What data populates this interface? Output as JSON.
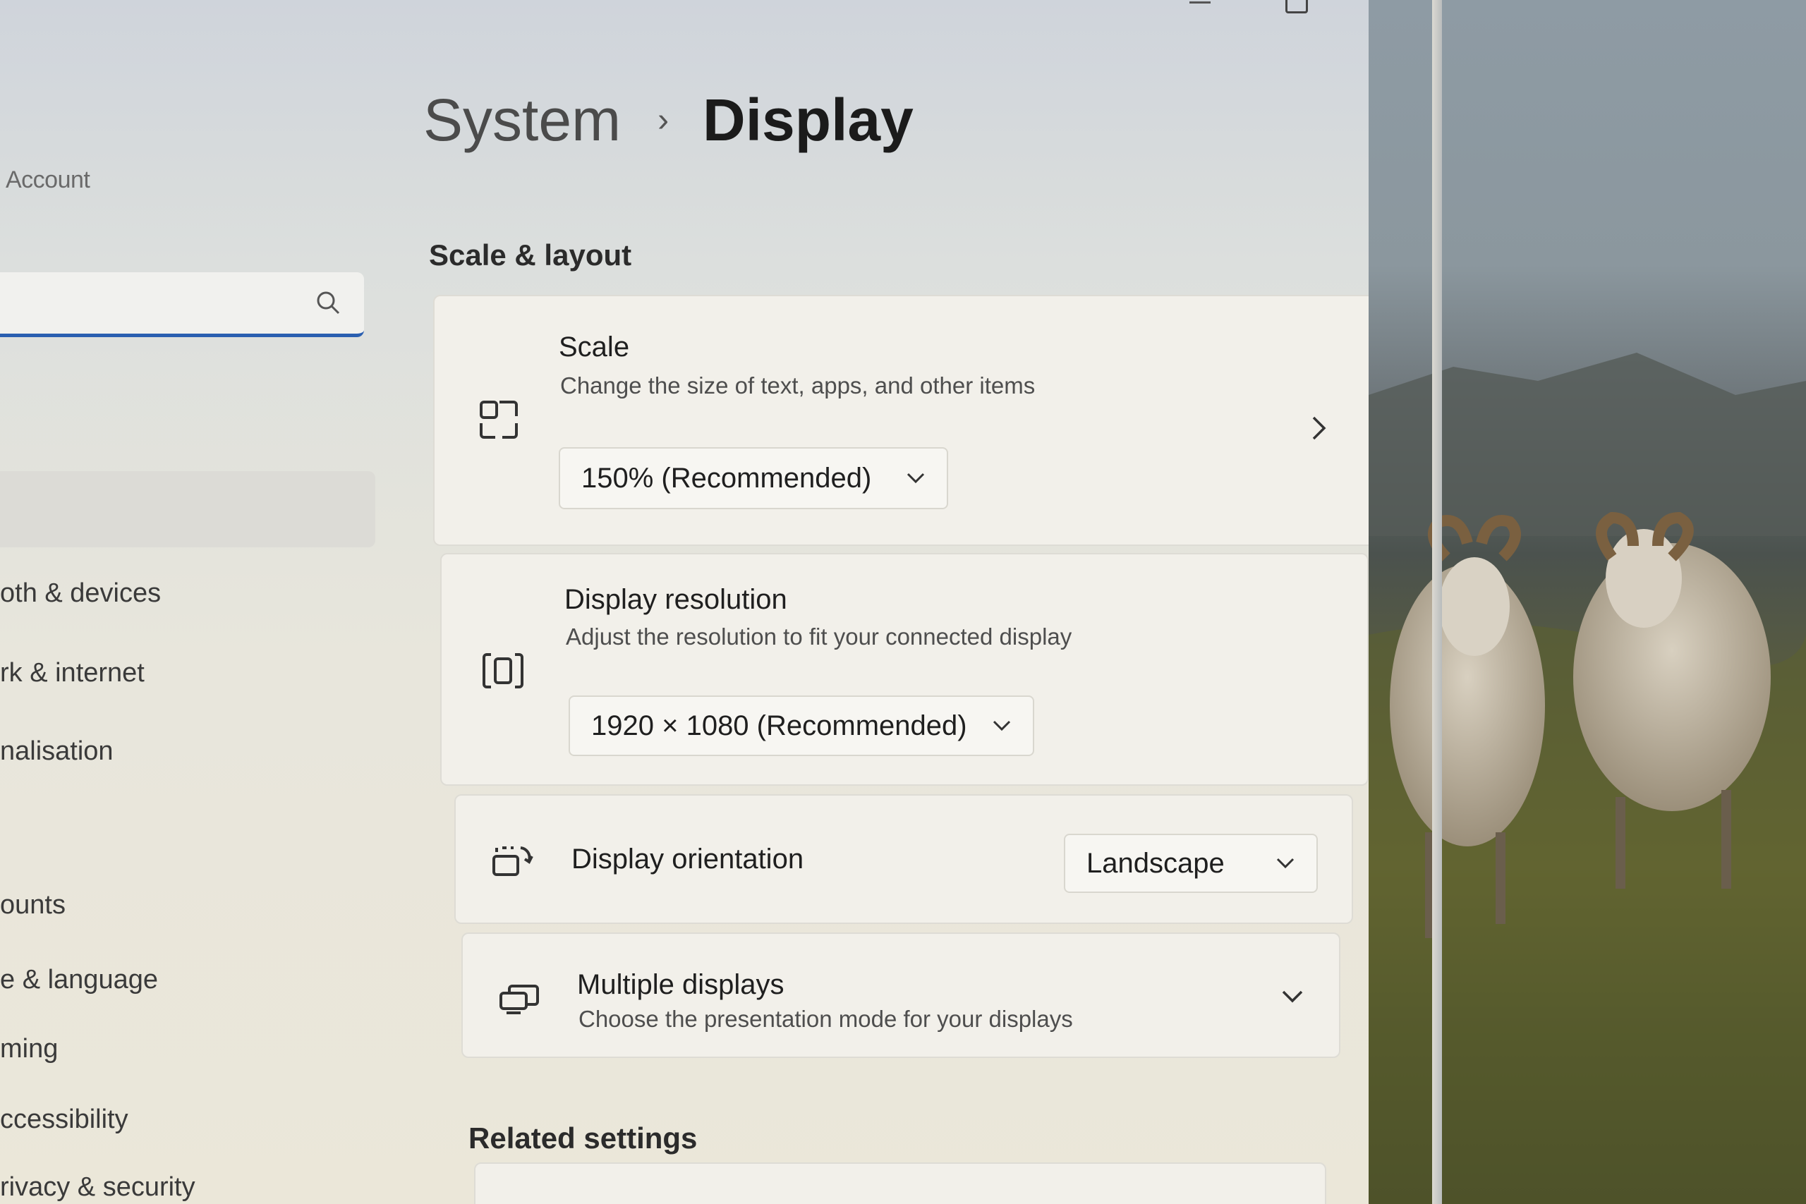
{
  "sidebar": {
    "account_label": "Account",
    "search_placeholder": "",
    "items": [
      {
        "label": "oth & devices"
      },
      {
        "label": "rk & internet"
      },
      {
        "label": "nalisation"
      },
      {
        "label": "ounts"
      },
      {
        "label": "e & language"
      },
      {
        "label": "ming"
      },
      {
        "label": "ccessibility"
      },
      {
        "label": "rivacy & security"
      }
    ]
  },
  "header": {
    "parent": "System",
    "separator": "›",
    "current": "Display"
  },
  "sections": {
    "scale_layout": "Scale & layout",
    "related": "Related settings"
  },
  "cards": {
    "scale": {
      "title": "Scale",
      "description": "Change the size of text, apps, and other items",
      "value": "150% (Recommended)"
    },
    "resolution": {
      "title": "Display resolution",
      "description": "Adjust the resolution to fit your connected display",
      "value": "1920 × 1080 (Recommended)"
    },
    "orientation": {
      "title": "Display orientation",
      "value": "Landscape"
    },
    "multiple": {
      "title": "Multiple displays",
      "description": "Choose the presentation mode for your displays"
    }
  },
  "colors": {
    "accent": "#2a5fb0",
    "card": "#f2f0ea"
  },
  "icons": [
    "search-icon",
    "scale-icon",
    "resolution-icon",
    "orientation-icon",
    "multiple-displays-icon",
    "chevron-right-icon",
    "chevron-down-icon",
    "minimize-icon",
    "maximize-icon",
    "close-icon"
  ]
}
